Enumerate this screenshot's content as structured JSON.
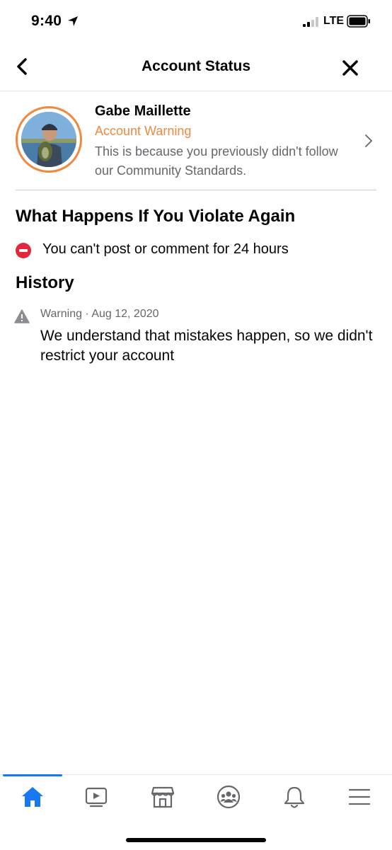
{
  "status_bar": {
    "time": "9:40",
    "network": "LTE"
  },
  "nav": {
    "title": "Account Status"
  },
  "profile": {
    "name": "Gabe Maillette",
    "status": "Account Warning",
    "description": "This is because you previously didn't follow our Community Standards."
  },
  "violate_section": {
    "title": "What Happens If You Violate Again",
    "restriction": "You can't post or comment for 24 hours"
  },
  "history": {
    "title": "History",
    "items": [
      {
        "meta": "Warning · Aug 12, 2020",
        "text": "We understand that mistakes happen, so we didn't restrict your account"
      }
    ]
  },
  "tabbar": {
    "tabs": [
      "home-icon",
      "video-icon",
      "marketplace-icon",
      "groups-icon",
      "notifications-icon",
      "menu-icon"
    ],
    "active": "home-icon"
  },
  "colors": {
    "accent": "#1877f2",
    "warning": "#f0883e",
    "danger": "#e4263c",
    "secondary_text": "#65676b"
  }
}
